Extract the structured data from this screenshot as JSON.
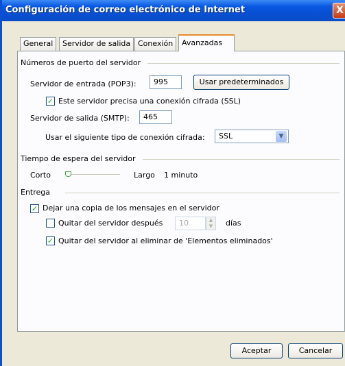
{
  "window": {
    "title": "Configuración de correo electrónico de Internet",
    "close_label": "X"
  },
  "tabs": [
    {
      "label": "General"
    },
    {
      "label": "Servidor de salida"
    },
    {
      "label": "Conexión"
    },
    {
      "label": "Avanzadas"
    }
  ],
  "ports": {
    "group_label": "Números de puerto del servidor",
    "incoming_label": "Servidor de entrada (POP3):",
    "incoming_value": "995",
    "defaults_button": "Usar predeterminados",
    "ssl_label": "Este servidor precisa una conexión cifrada (SSL)",
    "ssl_checked": true,
    "outgoing_label": "Servidor de salida (SMTP):",
    "outgoing_value": "465",
    "encryption_label": "Usar el siguiente tipo de conexión cifrada:",
    "encryption_value": "SSL"
  },
  "timeout": {
    "group_label": "Tiempo de espera del servidor",
    "short_label": "Corto",
    "long_label": "Largo",
    "value_label": "1 minuto",
    "level": 0.0
  },
  "delivery": {
    "group_label": "Entrega",
    "keep_copy_label": "Dejar una copia de los mensajes en el servidor",
    "keep_copy_checked": true,
    "remove_after_label": "Quitar del servidor después",
    "remove_after_checked": false,
    "remove_after_days": "10",
    "days_label": "días",
    "remove_deleted_label": "Quitar del servidor al eliminar de 'Elementos eliminados'",
    "remove_deleted_checked": true
  },
  "footer": {
    "ok_label": "Aceptar",
    "cancel_label": "Cancelar"
  },
  "colors": {
    "titlebar": "#0a58e2",
    "tab_highlight": "#e68b2c",
    "dialog_bg": "#ece9d8"
  }
}
